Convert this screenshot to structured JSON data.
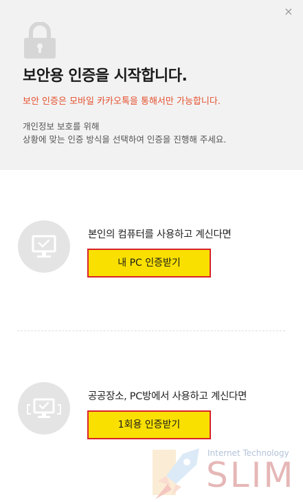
{
  "header": {
    "close_label": "×",
    "title": "보안용 인증을 시작합니다.",
    "warning": "보안 인증은 모바일 카카오톡을 통해서만 가능합니다.",
    "desc_line1": "개인정보 보호를 위해",
    "desc_line2": "상황에 맞는 인증 방식을 선택하여 인증을 진행해 주세요."
  },
  "options": [
    {
      "text": "본인의 컴퓨터를 사용하고 계신다면",
      "button_label": "내 PC 인증받기",
      "icon": "monitor-check-icon"
    },
    {
      "text": "공공장소, PC방에서 사용하고 계신다면",
      "button_label": "1회용 인증받기",
      "icon": "public-monitor-check-icon"
    }
  ],
  "watermark": {
    "tagline": "Internet Technology",
    "logo": "SLIM"
  },
  "colors": {
    "header_bg": "#f2f2f2",
    "warning": "#e5502d",
    "button_bg": "#f9e000",
    "button_border": "#d8222a"
  }
}
